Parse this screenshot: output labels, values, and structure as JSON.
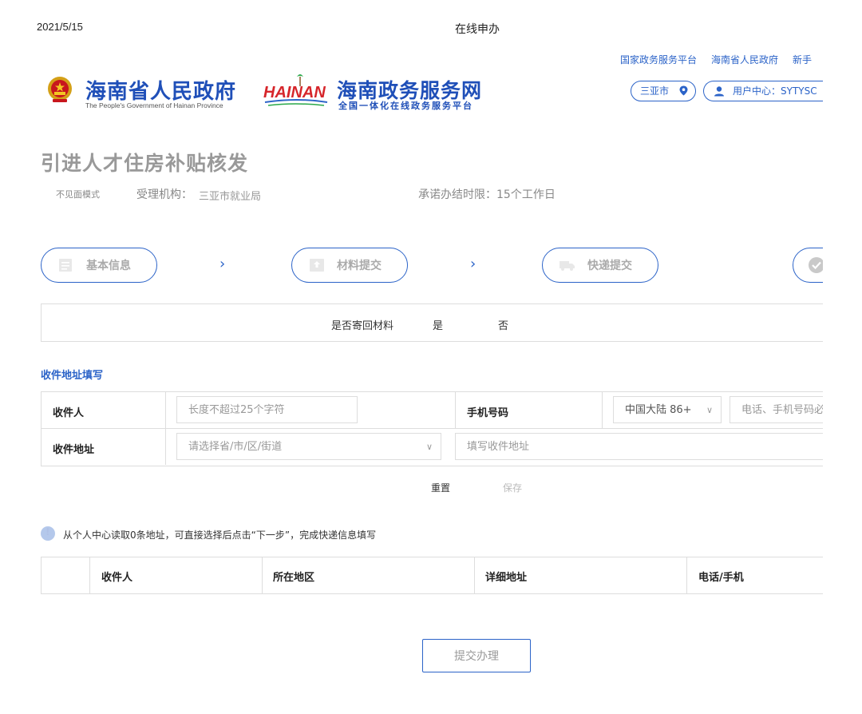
{
  "print_header": {
    "date": "2021/5/15",
    "title": "在线申办"
  },
  "top_links": [
    "国家政务服务平台",
    "海南省人民政府",
    "新手"
  ],
  "logos": {
    "gov_name": "海南省人民政府",
    "gov_subtitle": "The People's Government of Hainan Province",
    "service_name": "海南政务服务网",
    "service_subtitle": "全国一体化在线政务服务平台",
    "hainan_mark": "HAINAN"
  },
  "header_controls": {
    "city": "三亚市",
    "user_center": "用户中心：SYTYSC"
  },
  "page": {
    "title": "引进人才住房补贴核发",
    "mode": "不见面模式",
    "agency_label": "受理机构：",
    "agency_value": "三亚市就业局",
    "deadline": "承诺办结时限：15个工作日"
  },
  "steps": [
    {
      "label": "基本信息"
    },
    {
      "label": "材料提交"
    },
    {
      "label": "快递提交"
    },
    {
      "label": ""
    }
  ],
  "return_materials": {
    "label": "是否寄回材料",
    "yes": "是",
    "no": "否"
  },
  "address_form": {
    "section_title": "收件地址填写",
    "recipient_label": "收件人",
    "recipient_placeholder": "长度不超过25个字符",
    "phone_label": "手机号码",
    "region_code": "中国大陆 86+",
    "phone_placeholder": "电话、手机号码必",
    "address_label": "收件地址",
    "region_placeholder": "请选择省/市/区/街道",
    "detail_placeholder": "填写收件地址",
    "reset_label": "重置",
    "save_label": "保存"
  },
  "notice": "从个人中心读取0条地址，可直接选择后点击“下一步”，完成快递信息填写",
  "address_table": {
    "columns": [
      "收件人",
      "所在地区",
      "详细地址",
      "电话/手机"
    ]
  },
  "submit_label": "提交办理",
  "colors": {
    "accent": "#2b63c8",
    "border": "#dddddd",
    "muted": "#999999"
  }
}
